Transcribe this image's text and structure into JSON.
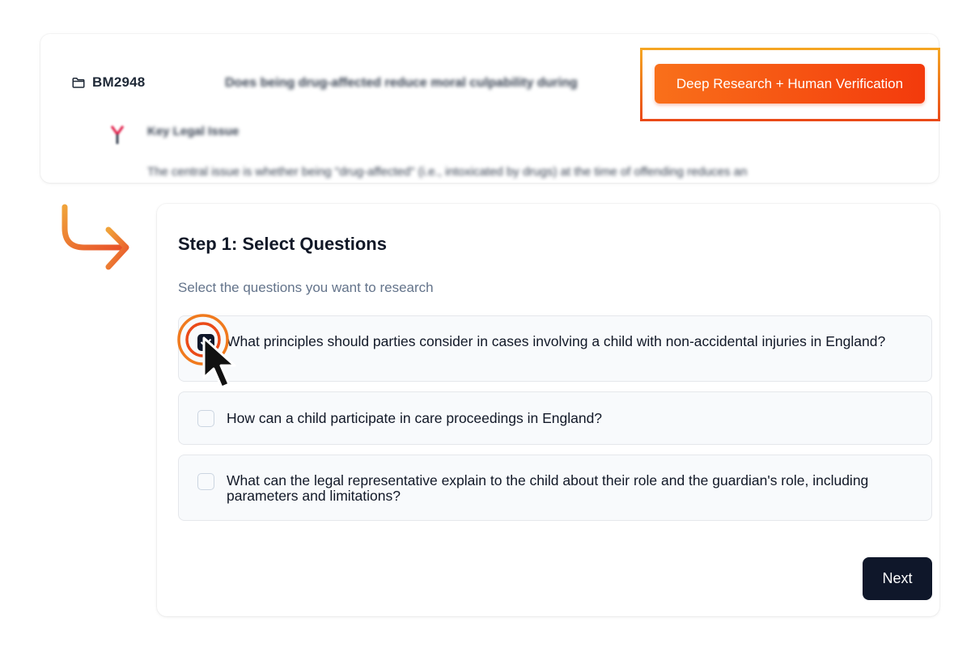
{
  "case": {
    "id": "BM2948",
    "question": "Does being drug-affected reduce moral culpability during",
    "issue_title": "Key Legal Issue",
    "issue_text": "The central issue is whether being \"drug-affected\" (i.e., intoxicated by drugs) at the time of offending reduces an"
  },
  "toolbar": {
    "deep_research_label": "Deep Research + Human Verification"
  },
  "step": {
    "title": "Step 1: Select Questions",
    "subtitle": "Select the questions you want to research",
    "questions": [
      {
        "text": "What principles should parties consider in cases involving a child with non-accidental injuries in England?",
        "checked": true
      },
      {
        "text": "How can a child participate in care proceedings in England?",
        "checked": false
      },
      {
        "text": "What can the legal representative explain to the child about their role and the guardian's role, including parameters and limitations?",
        "checked": false
      }
    ],
    "next_label": "Next"
  },
  "colors": {
    "accent_orange": "#f9701a",
    "accent_red": "#f33a0c",
    "primary_dark": "#0f172a"
  },
  "icons": {
    "folder": "folder-icon",
    "issue": "scale-icon",
    "arrow": "curved-arrow-icon",
    "cursor": "mouse-pointer-icon"
  }
}
